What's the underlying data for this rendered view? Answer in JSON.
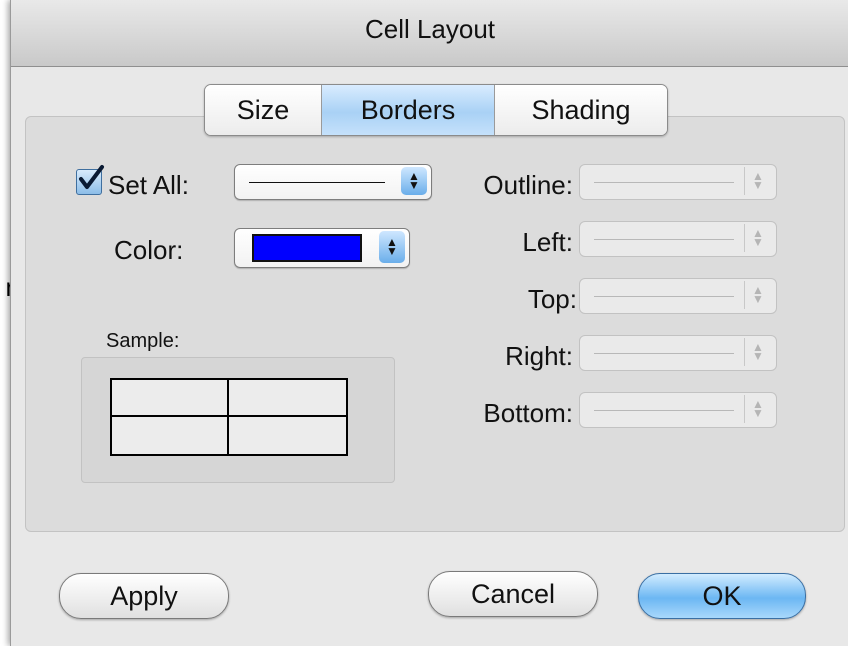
{
  "background_window": {
    "partial_text": "n"
  },
  "dialog": {
    "title": "Cell Layout",
    "tabs": [
      {
        "label": "Size",
        "selected": false
      },
      {
        "label": "Borders",
        "selected": true
      },
      {
        "label": "Shading",
        "selected": false
      }
    ],
    "set_all": {
      "label": "Set All:",
      "checked": true,
      "style": "solid line"
    },
    "color": {
      "label": "Color:",
      "value": "#0000ff"
    },
    "sample_label": "Sample:",
    "borders": [
      {
        "label": "Outline:",
        "enabled": false
      },
      {
        "label": "Left:",
        "enabled": false
      },
      {
        "label": "Top:",
        "enabled": false
      },
      {
        "label": "Right:",
        "enabled": false
      },
      {
        "label": "Bottom:",
        "enabled": false
      }
    ],
    "buttons": {
      "apply": "Apply",
      "cancel": "Cancel",
      "ok": "OK"
    }
  },
  "icons": {
    "checkmark": "check-icon",
    "stepper": "up-down-arrows-icon"
  },
  "colors": {
    "accent": "#6cb7f3",
    "selected_tab": "#a9d1f5",
    "swatch": "#0000ff"
  }
}
